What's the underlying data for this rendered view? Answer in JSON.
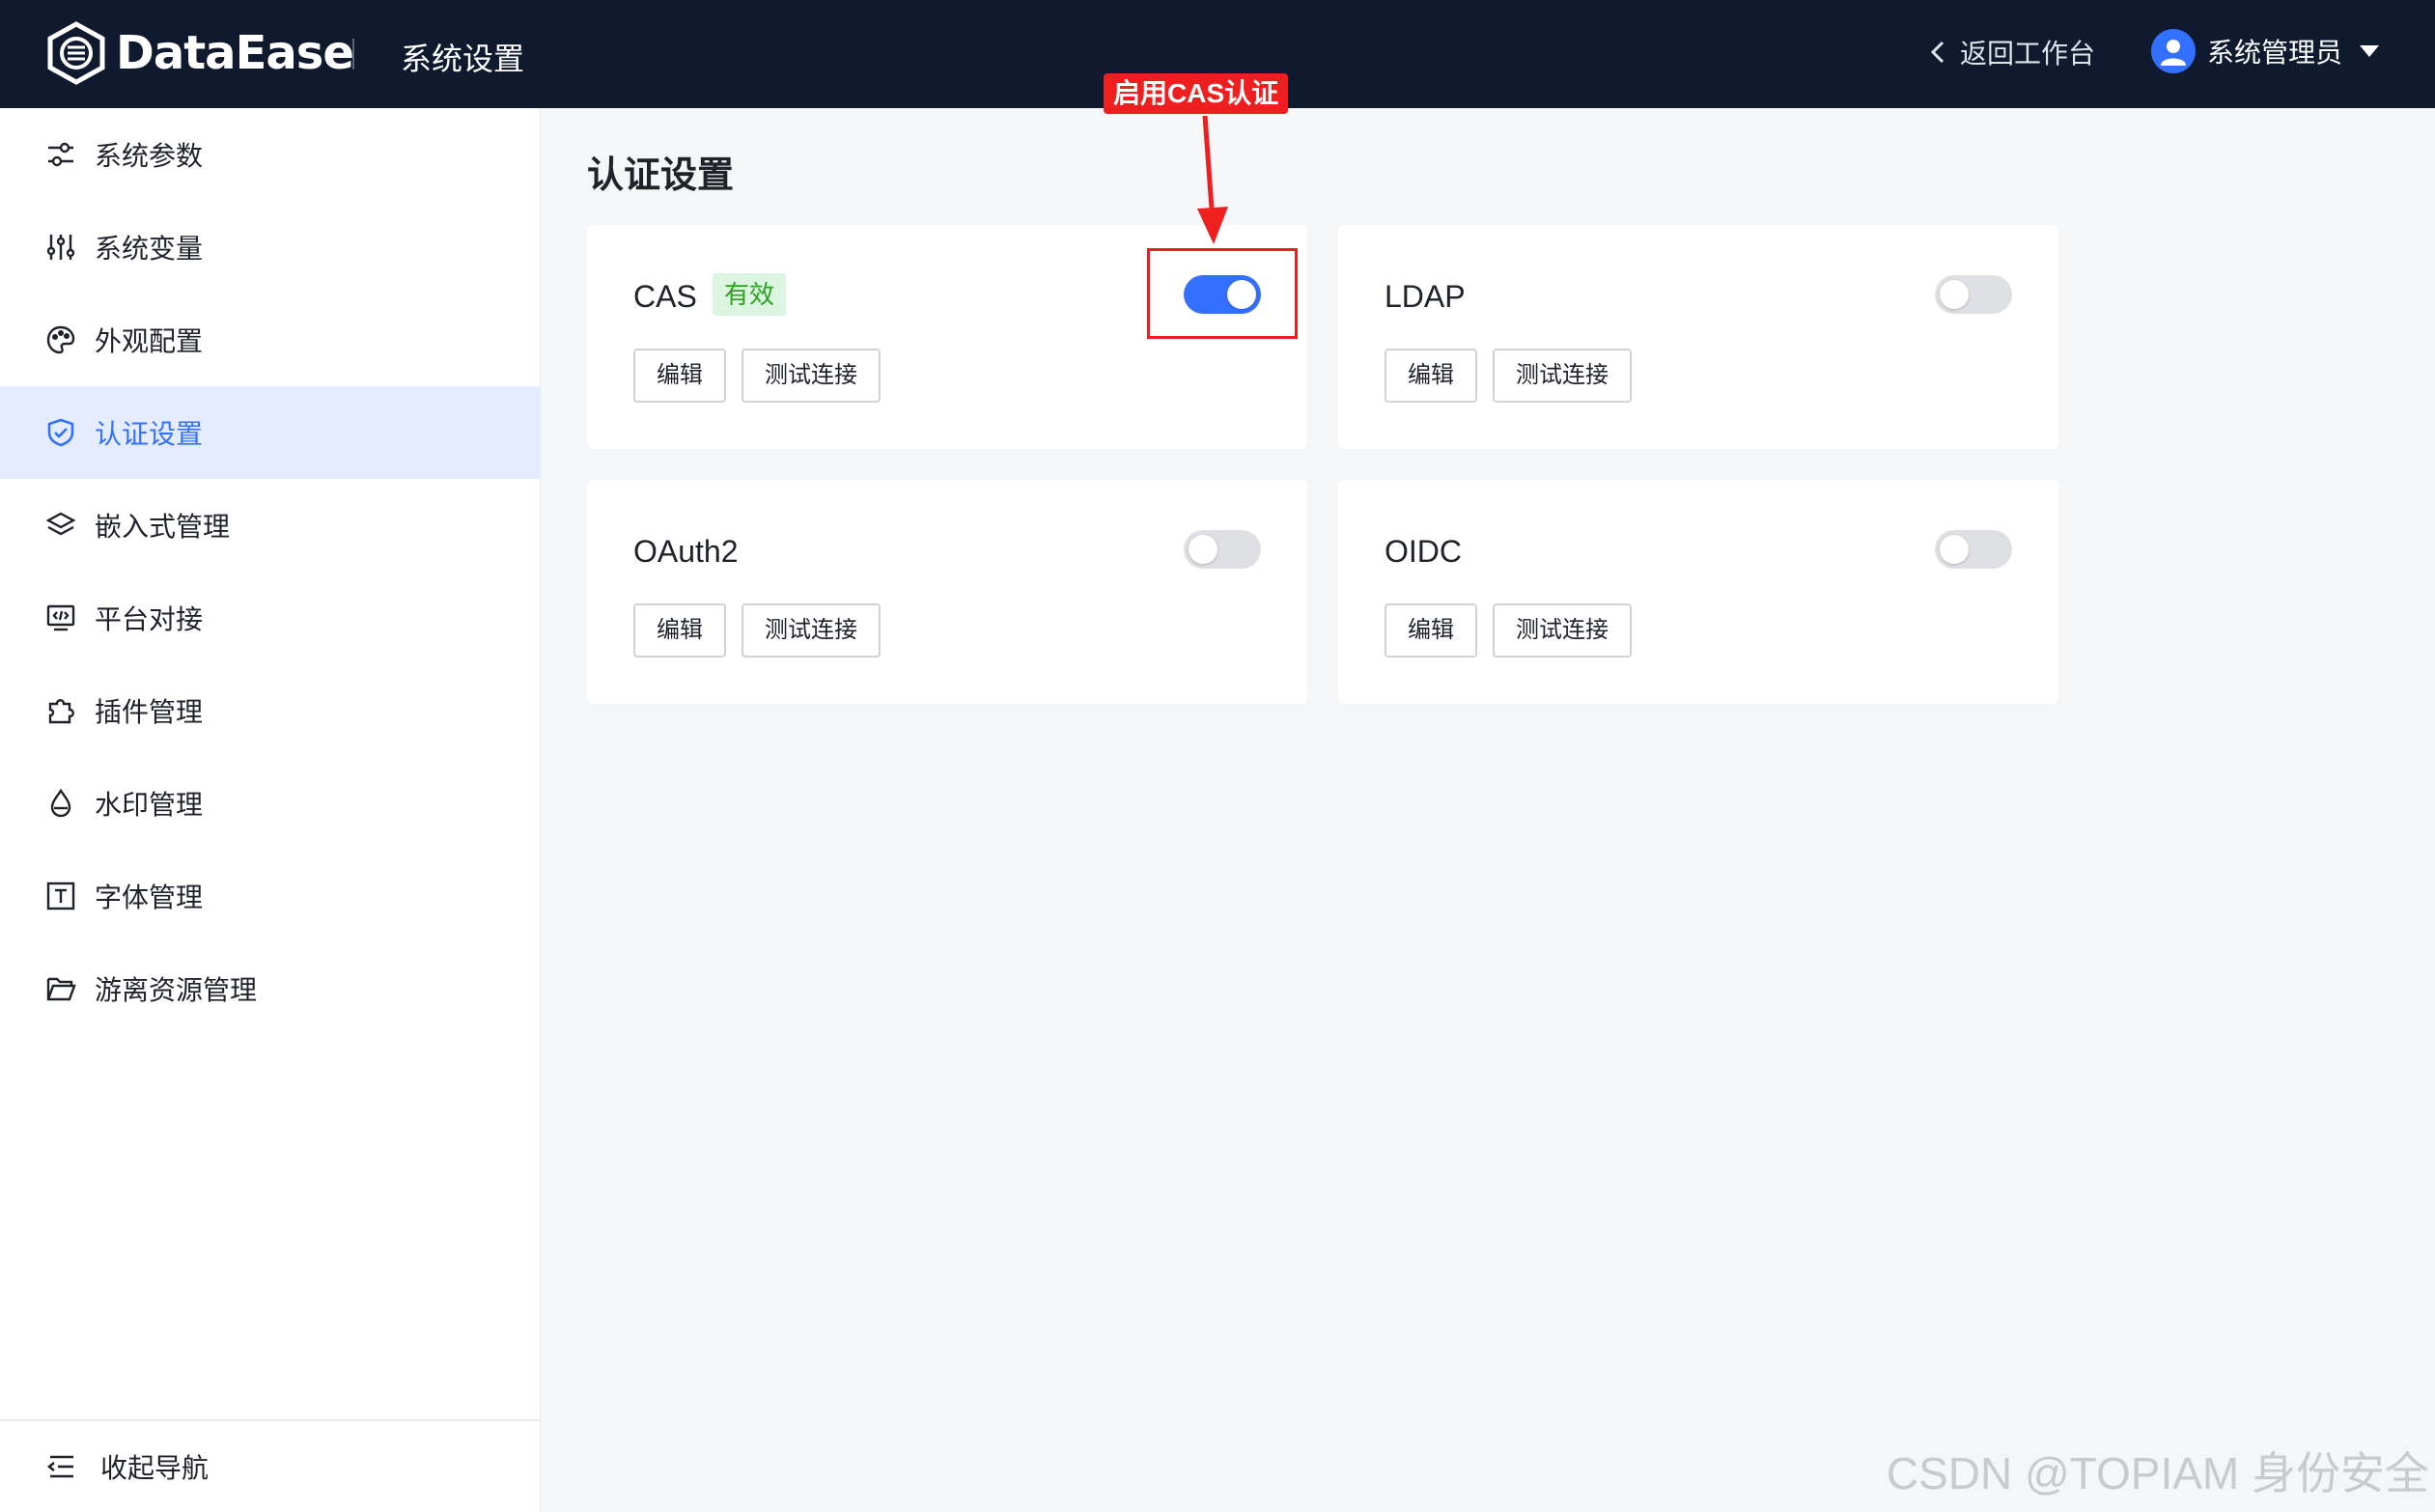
{
  "header": {
    "brand": "DataEase",
    "title": "系统设置",
    "back_label": "返回工作台",
    "user_name": "系统管理员"
  },
  "sidebar": {
    "items": [
      {
        "label": "系统参数",
        "icon": "sliders-icon"
      },
      {
        "label": "系统变量",
        "icon": "variable-icon"
      },
      {
        "label": "外观配置",
        "icon": "palette-icon"
      },
      {
        "label": "认证设置",
        "icon": "shield-icon",
        "active": true
      },
      {
        "label": "嵌入式管理",
        "icon": "layers-icon"
      },
      {
        "label": "平台对接",
        "icon": "monitor-code-icon"
      },
      {
        "label": "插件管理",
        "icon": "puzzle-icon"
      },
      {
        "label": "水印管理",
        "icon": "drop-icon"
      },
      {
        "label": "字体管理",
        "icon": "font-icon"
      },
      {
        "label": "游离资源管理",
        "icon": "folder-icon"
      }
    ],
    "collapse_label": "收起导航"
  },
  "main": {
    "title": "认证设置",
    "cards": [
      {
        "name": "CAS",
        "badge": "有效",
        "enabled": true,
        "edit_label": "编辑",
        "test_label": "测试连接"
      },
      {
        "name": "LDAP",
        "badge": "",
        "enabled": false,
        "edit_label": "编辑",
        "test_label": "测试连接"
      },
      {
        "name": "OAuth2",
        "badge": "",
        "enabled": false,
        "edit_label": "编辑",
        "test_label": "测试连接"
      },
      {
        "name": "OIDC",
        "badge": "",
        "enabled": false,
        "edit_label": "编辑",
        "test_label": "测试连接"
      }
    ]
  },
  "annotation": {
    "label": "启用CAS认证",
    "color": "#f01f1f"
  },
  "watermark": "CSDN @TOPIAM 身份安全",
  "colors": {
    "header_bg": "#0f1a2f",
    "accent": "#3370ff",
    "badge_bg": "#dcf5e0",
    "badge_text": "#2ea121"
  }
}
